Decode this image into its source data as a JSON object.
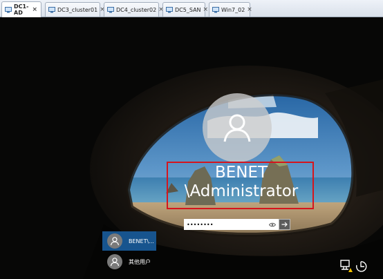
{
  "tabs": [
    {
      "label": "DC1-AD",
      "active": true
    },
    {
      "label": "DC3_cluster01",
      "active": false
    },
    {
      "label": "DC4_cluster02",
      "active": false
    },
    {
      "label": "DC5_SAN",
      "active": false
    },
    {
      "label": "Win7_02",
      "active": false
    }
  ],
  "tab_close_glyph": "×",
  "login": {
    "username": "BENET\n\\Administrator",
    "password_value": "••••••••",
    "avatar_icon": "user-icon",
    "reveal_icon": "eye-icon",
    "submit_icon": "arrow-right-icon"
  },
  "user_list": [
    {
      "label": "BENET\\...",
      "selected": true
    },
    {
      "label": "其他用户",
      "selected": false
    }
  ],
  "bottom_icons": [
    "network-icon",
    "ease-of-access-icon",
    "power-icon"
  ],
  "colors": {
    "highlight_box": "#d6141c",
    "selected_user": "#17548e"
  }
}
